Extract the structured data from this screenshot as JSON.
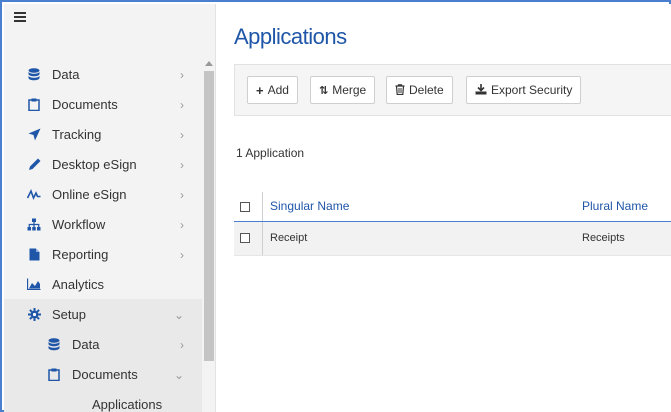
{
  "sidebar": {
    "items": [
      {
        "label": "Data",
        "icon": "database-icon",
        "chevron": "›"
      },
      {
        "label": "Documents",
        "icon": "clipboard-icon",
        "chevron": "›"
      },
      {
        "label": "Tracking",
        "icon": "send-icon",
        "chevron": "›"
      },
      {
        "label": "Desktop eSign",
        "icon": "pen-icon",
        "chevron": "›"
      },
      {
        "label": "Online eSign",
        "icon": "signature-icon",
        "chevron": "›"
      },
      {
        "label": "Workflow",
        "icon": "sitemap-icon",
        "chevron": "›"
      },
      {
        "label": "Reporting",
        "icon": "file-icon",
        "chevron": "›"
      },
      {
        "label": "Analytics",
        "icon": "area-chart-icon",
        "chevron": ""
      },
      {
        "label": "Setup",
        "icon": "gear-icon",
        "chevron": "⌄"
      }
    ],
    "setup_children": [
      {
        "label": "Data",
        "icon": "database-icon",
        "chevron": "›"
      },
      {
        "label": "Documents",
        "icon": "clipboard-icon",
        "chevron": "⌄"
      }
    ],
    "documents_children": [
      {
        "label": "Applications"
      }
    ]
  },
  "main": {
    "title": "Applications",
    "toolbar": {
      "add_label": "Add",
      "merge_label": "Merge",
      "delete_label": "Delete",
      "export_label": "Export Security"
    },
    "count_text": "1 Application",
    "table": {
      "columns": [
        "Singular Name",
        "Plural Name"
      ],
      "rows": [
        {
          "singular": "Receipt",
          "plural": "Receipts"
        }
      ]
    }
  },
  "colors": {
    "accent": "#1f56a8",
    "frame_border": "#4a7fd0",
    "icon_blue": "#1f56a8"
  }
}
